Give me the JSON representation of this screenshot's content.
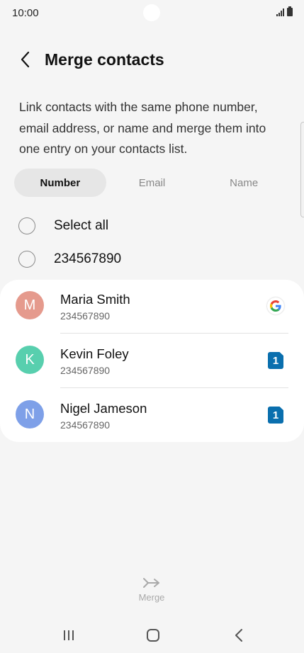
{
  "status_bar": {
    "time": "10:00"
  },
  "header": {
    "title": "Merge contacts"
  },
  "description": "Link contacts with the same phone number, email address, or name and merge them into one entry on your contacts list.",
  "tabs": [
    {
      "label": "Number",
      "active": true
    },
    {
      "label": "Email",
      "active": false
    },
    {
      "label": "Name",
      "active": false
    }
  ],
  "select_all_label": "Select all",
  "group_number": "234567890",
  "contacts": [
    {
      "initial": "M",
      "name": "Maria Smith",
      "number": "234567890",
      "avatar_color": "#e59a8d",
      "account": "google-icon"
    },
    {
      "initial": "K",
      "name": "Kevin Foley",
      "number": "234567890",
      "avatar_color": "#58cfae",
      "account": "sim-1-icon",
      "account_label": "1"
    },
    {
      "initial": "N",
      "name": "Nigel Jameson",
      "number": "234567890",
      "avatar_color": "#7ea0e8",
      "account": "sim-1-icon",
      "account_label": "1"
    }
  ],
  "merge_label": "Merge",
  "colors": {
    "sim_badge": "#0a6fae",
    "background": "#f5f5f5",
    "card": "#ffffff"
  }
}
